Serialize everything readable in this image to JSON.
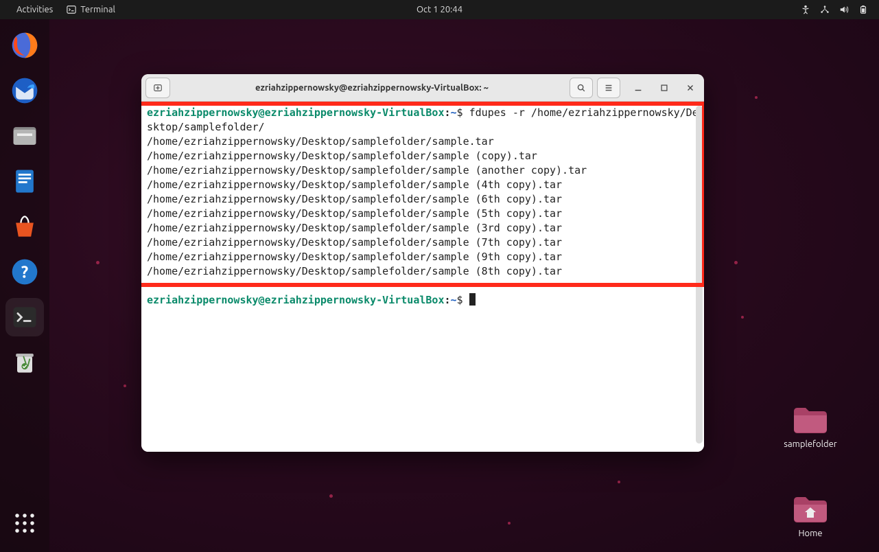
{
  "topbar": {
    "activities_label": "Activities",
    "app_label": "Terminal",
    "datetime": "Oct 1  20:44"
  },
  "dock": {
    "items": [
      {
        "name": "firefox-icon"
      },
      {
        "name": "thunderbird-icon"
      },
      {
        "name": "files-icon"
      },
      {
        "name": "writer-icon"
      },
      {
        "name": "software-icon"
      },
      {
        "name": "help-icon"
      },
      {
        "name": "terminal-icon",
        "active": true
      },
      {
        "name": "trash-icon"
      }
    ]
  },
  "desktop": {
    "sample_label": "samplefolder",
    "home_label": "Home"
  },
  "terminal": {
    "window_title": "ezriahzippernowsky@ezriahzippernowsky-VirtualBox: ~",
    "prompt_user": "ezriahzippernowsky@ezriahzippernowsky-VirtualBox",
    "prompt_colon": ":",
    "prompt_path": "~",
    "prompt_dollar": "$",
    "command": "fdupes -r /home/ezriahzippernowsky/Desktop/samplefolder/",
    "output_lines": [
      "/home/ezriahzippernowsky/Desktop/samplefolder/sample.tar",
      "/home/ezriahzippernowsky/Desktop/samplefolder/sample (copy).tar",
      "/home/ezriahzippernowsky/Desktop/samplefolder/sample (another copy).tar",
      "/home/ezriahzippernowsky/Desktop/samplefolder/sample (4th copy).tar",
      "/home/ezriahzippernowsky/Desktop/samplefolder/sample (6th copy).tar",
      "/home/ezriahzippernowsky/Desktop/samplefolder/sample (5th copy).tar",
      "/home/ezriahzippernowsky/Desktop/samplefolder/sample (3rd copy).tar",
      "/home/ezriahzippernowsky/Desktop/samplefolder/sample (7th copy).tar",
      "/home/ezriahzippernowsky/Desktop/samplefolder/sample (9th copy).tar",
      "/home/ezriahzippernowsky/Desktop/samplefolder/sample (8th copy).tar"
    ]
  }
}
